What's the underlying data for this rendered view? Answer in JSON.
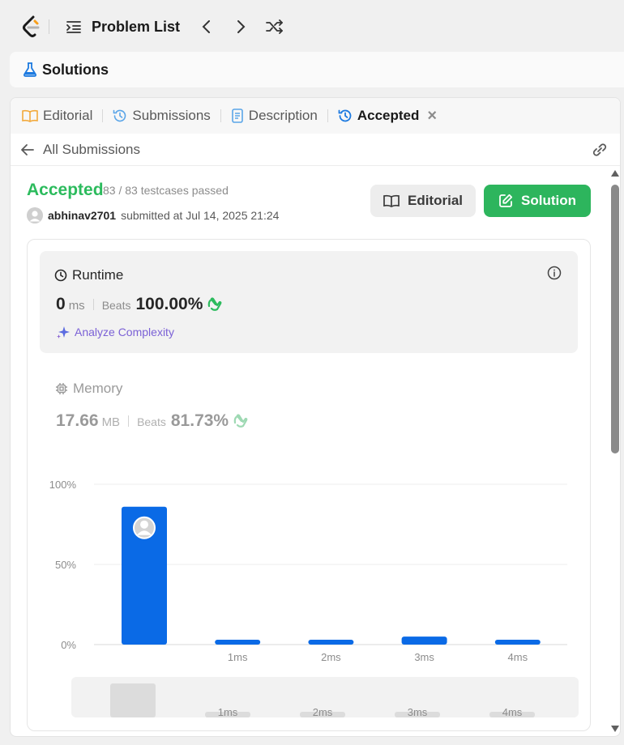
{
  "topbar": {
    "problem_list_label": "Problem List"
  },
  "solutions_bar": {
    "label": "Solutions"
  },
  "tabs": [
    {
      "label": "Editorial"
    },
    {
      "label": "Submissions"
    },
    {
      "label": "Description"
    },
    {
      "label": "Accepted"
    }
  ],
  "nav": {
    "all_submissions": "All Submissions"
  },
  "result": {
    "status": "Accepted",
    "testcases": "83 / 83 testcases passed",
    "author": "abhinav2701",
    "submitted_text": "submitted at Jul 14, 2025 21:24"
  },
  "buttons": {
    "editorial": "Editorial",
    "solution": "Solution"
  },
  "runtime": {
    "title": "Runtime",
    "value": "0",
    "unit": "ms",
    "beats_label": "Beats",
    "beats_pct": "100.00%",
    "analyze": "Analyze Complexity"
  },
  "memory": {
    "title": "Memory",
    "value": "17.66",
    "unit": "MB",
    "beats_label": "Beats",
    "beats_pct": "81.73%"
  },
  "colors": {
    "accent_green": "#2cbb5d",
    "bar_blue": "#0a6ae6",
    "analyze_purple": "#7b61d6"
  },
  "chart_data": {
    "type": "bar",
    "categories": [
      "",
      "1ms",
      "2ms",
      "3ms",
      "4ms"
    ],
    "values": [
      86,
      3,
      3,
      5,
      3
    ],
    "ylim": [
      0,
      100
    ],
    "yticks": [
      "0%",
      "50%",
      "100%"
    ],
    "highlight_index": 0,
    "grid": true
  },
  "minimap": {
    "labels": [
      "1ms",
      "2ms",
      "3ms",
      "4ms"
    ]
  }
}
